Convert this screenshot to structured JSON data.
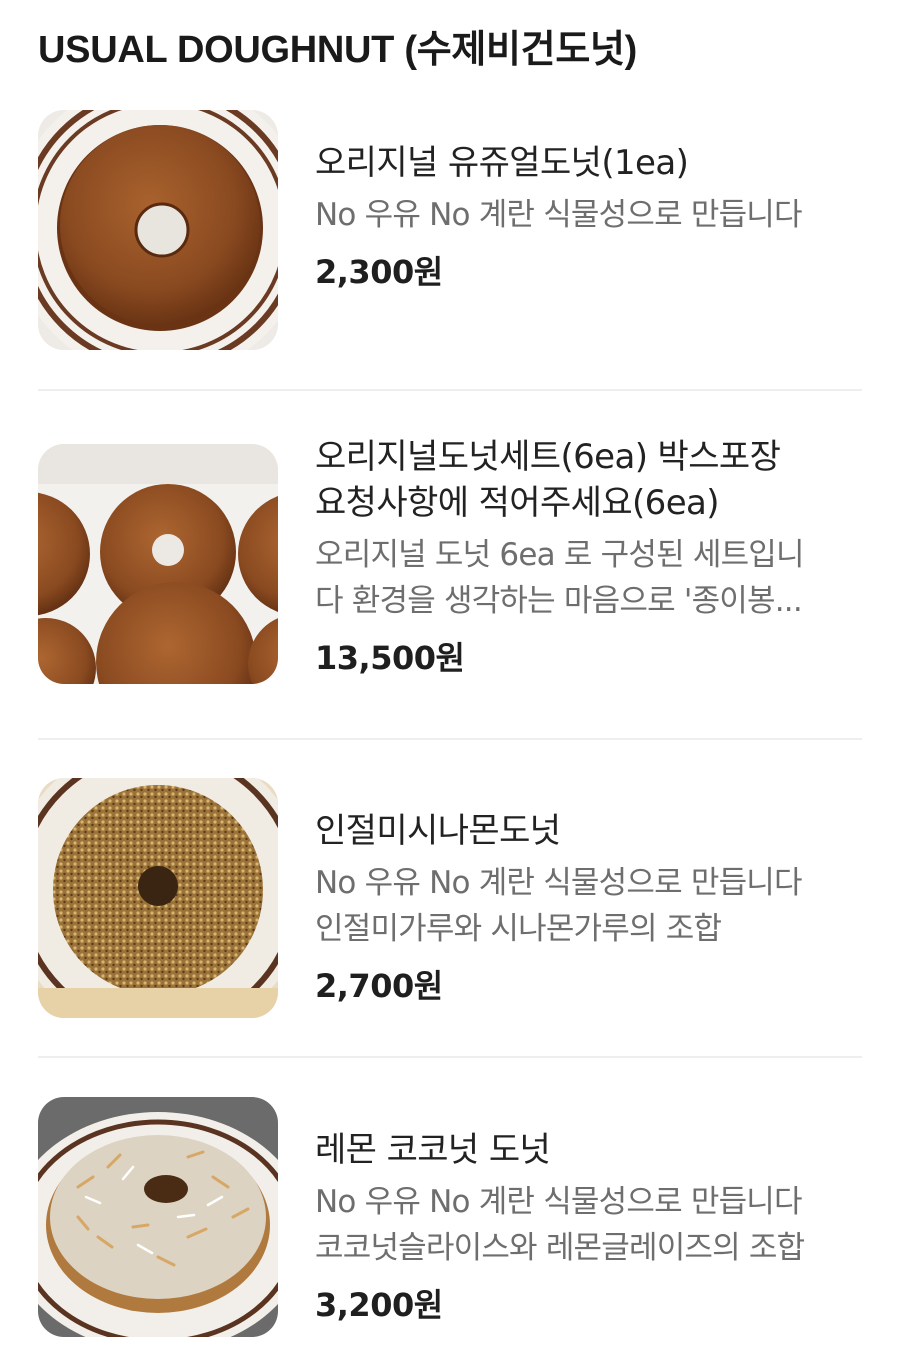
{
  "section": {
    "title": "USUAL DOUGHNUT (수제비건도넛)"
  },
  "items": [
    {
      "name": "오리지널 유쥬얼도넛(1ea)",
      "description": "No 우유 No 계란 식물성으로 만듭니다",
      "price": "2,300원",
      "image_icon": "glazed-doughnut-photo"
    },
    {
      "name": "오리지널도넛세트(6ea) 박스포장\n요청사항에 적어주세요(6ea)",
      "description": "오리지널 도넛 6ea 로 구성된 세트입니\n다 환경을 생각하는 마음으로 '종이봉...",
      "price": "13,500원",
      "image_icon": "boxed-doughnuts-photo"
    },
    {
      "name": "인절미시나몬도넛",
      "description": "No 우유 No 계란 식물성으로 만듭니다\n인절미가루와 시나몬가루의 조합",
      "price": "2,700원",
      "image_icon": "injeolmi-cinnamon-doughnut-photo"
    },
    {
      "name": "레몬 코코넛 도넛",
      "description": "No 우유 No 계란 식물성으로 만듭니다\n코코넛슬라이스와 레몬글레이즈의 조합",
      "price": "3,200원",
      "image_icon": "lemon-coconut-doughnut-photo"
    }
  ]
}
